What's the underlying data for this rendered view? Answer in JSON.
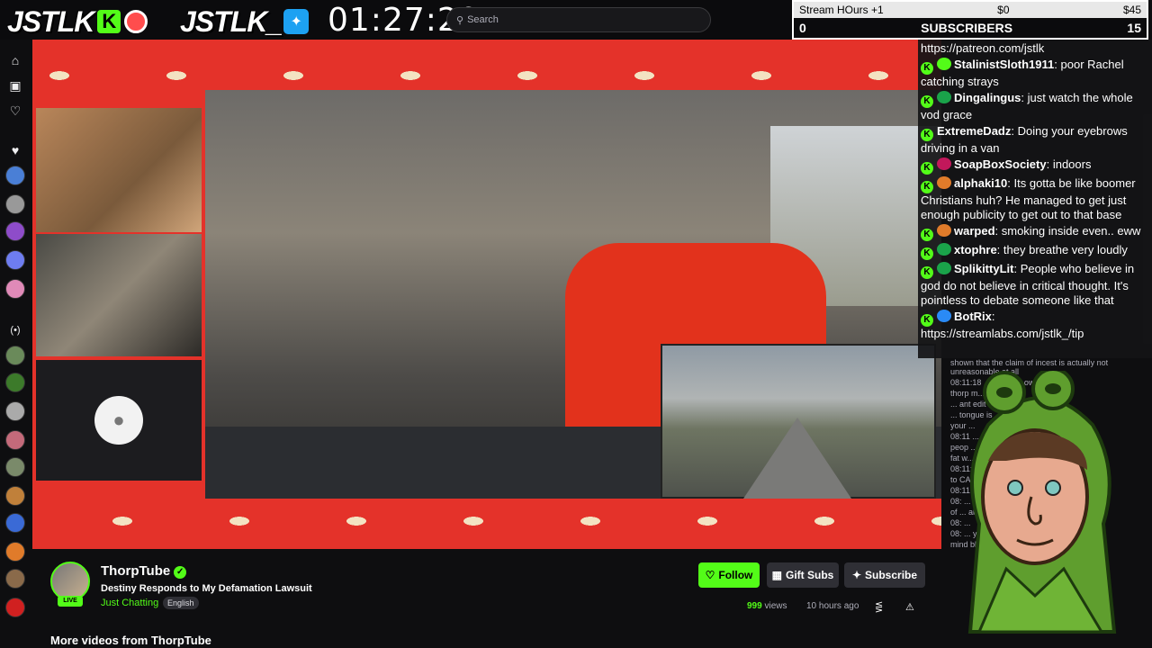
{
  "brand": {
    "logo_primary": "JSTLK",
    "logo_kick_letter": "K",
    "logo_secondary": "JSTLK_",
    "kick_color": "#53fc18"
  },
  "timer": "01:27:29",
  "search": {
    "placeholder": "Search"
  },
  "counter": {
    "top_label": "Stream HOurs +1",
    "top_mid": "$0",
    "top_right": "$45",
    "count_left": "0",
    "title": "SUBSCRIBERS",
    "count_right": "15"
  },
  "chat": {
    "header_line": "https://patreon.com/jstlk",
    "messages": [
      {
        "user": "StalinistSloth1911",
        "text": "poor Rachel catching strays",
        "bubble": "#53fc18"
      },
      {
        "user": "Dingalingus",
        "text": "just watch the whole vod grace",
        "bubble": "#1aa34a"
      },
      {
        "user": "ExtremeDadz",
        "text": "Doing your eyebrows driving in a van",
        "bubble": ""
      },
      {
        "user": "SoapBoxSociety",
        "text": "indoors",
        "bubble": "#c2185b"
      },
      {
        "user": "alphaki10",
        "text": "Its gotta be like boomer Christians huh? He managed to get just enough publicity to get out to that base",
        "bubble": "#e07b2a"
      },
      {
        "user": "warped",
        "text": "smoking inside even.. eww",
        "bubble": "#e07b2a"
      },
      {
        "user": "xtophre",
        "text": "they breathe very loudly",
        "bubble": "#1aa34a"
      },
      {
        "user": "SplikittyLit",
        "text": "People who believe in god do not believe in critical thought. It's pointless to debate someone like that",
        "bubble": "#1aa34a"
      },
      {
        "user": "BotRix",
        "text": "https://streamlabs.com/jstlk_/tip",
        "bubble": "#2a8af6"
      }
    ]
  },
  "side_chat": [
    "shown that the claim of incest is actually not unreasonable at all",
    "08:11:18 ... om your own",
    "thorp m...",
    "... ant edit it",
    "... tongue is",
    "your ...",
    "08:11 ... o claim",
    "peop ... s his wife a",
    "fat w...",
    "08:11:46 ... ou DREIVING",
    "to CA?",
    "08:11 ... insane.",
    "08: ... horps",
    "of ... ake",
    "08: ...",
    "08: ... y is just",
    "mind blowing"
  ],
  "channel": {
    "name": "ThorpTube",
    "live_label": "LIVE",
    "stream_title": "Destiny Responds to My Defamation Lawsuit",
    "category": "Just Chatting",
    "language": "English",
    "follow_label": "Follow",
    "gift_label": "Gift Subs",
    "subscribe_label": "Subscribe",
    "views_count": "999",
    "views_label": "views",
    "age": "10 hours ago",
    "more_videos": "More videos from ThorpTube"
  }
}
